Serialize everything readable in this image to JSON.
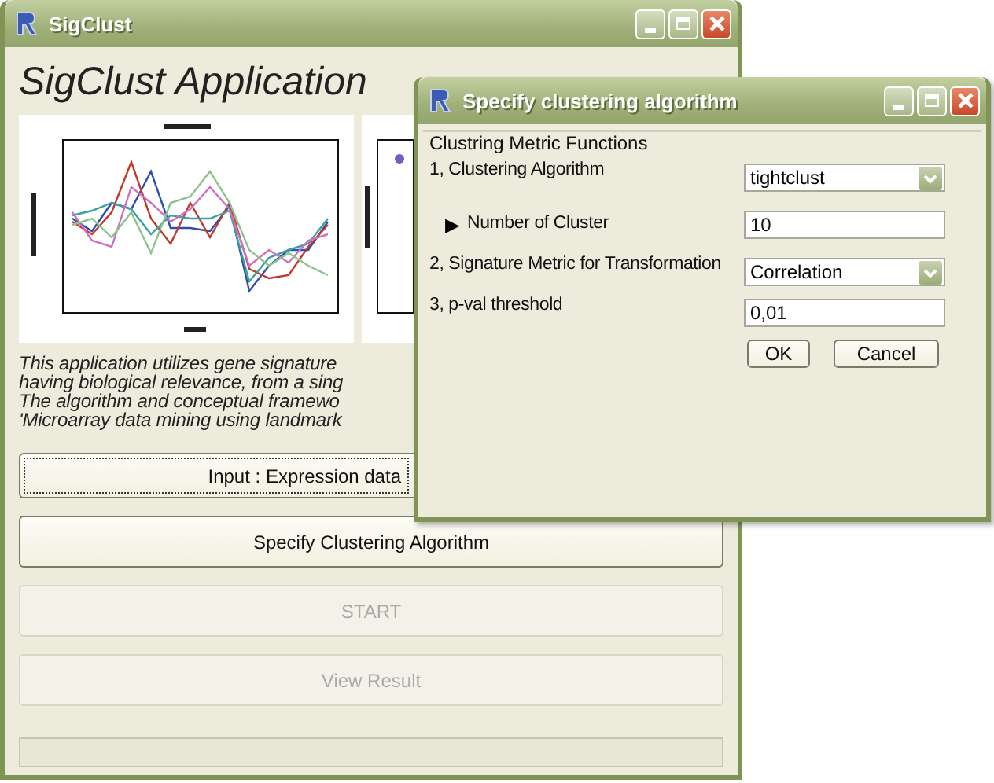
{
  "main_window": {
    "title": "SigClust",
    "heading": "SigClust Application",
    "description_lines": [
      "This application utilizes gene signature",
      "having biological relevance, from a sing",
      "The algorithm and conceptual framewo",
      "'Microarray data mining using landmark"
    ],
    "buttons": [
      {
        "label": "Input : Expression data",
        "disabled": false,
        "focused": true
      },
      {
        "label": "Specify Clustering Algorithm",
        "disabled": false,
        "focused": false
      },
      {
        "label": "START",
        "disabled": true,
        "focused": false
      },
      {
        "label": "View Result",
        "disabled": true,
        "focused": false
      }
    ]
  },
  "dialog": {
    "title": "Specify clustering algorithm",
    "group_label": "Clustring Metric Functions",
    "fields": [
      {
        "kind": "dropdown",
        "label": "1, Clustering Algorithm",
        "value": "tightclust"
      },
      {
        "kind": "text",
        "marker": "▶",
        "label": "Number of Cluster",
        "value": "10"
      },
      {
        "kind": "dropdown",
        "label": "2, Signature Metric for Transformation",
        "value": "Correlation"
      },
      {
        "kind": "text",
        "label": "3, p-val threshold",
        "value": "0,01"
      }
    ],
    "buttons": [
      "OK",
      "Cancel"
    ]
  }
}
